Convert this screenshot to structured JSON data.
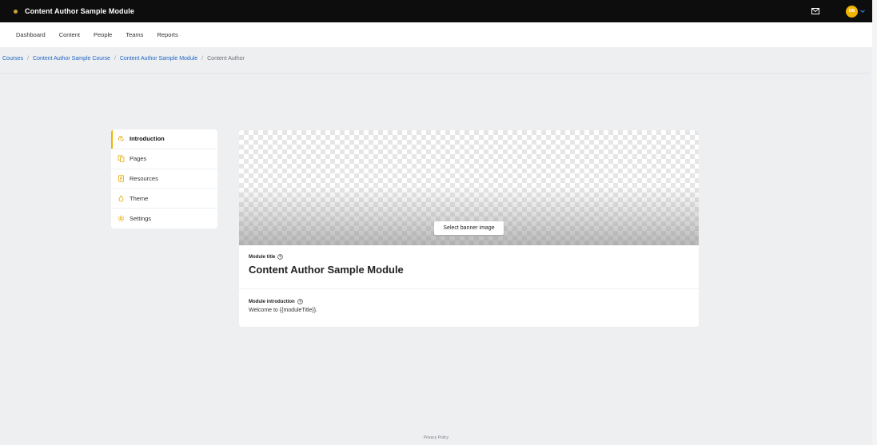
{
  "header": {
    "app_title": "Content Author Sample Module",
    "avatar_initials": "DB",
    "icons": {
      "mail": "mail-icon",
      "chevron": "chevron-down-icon"
    }
  },
  "nav": {
    "items": [
      "Dashboard",
      "Content",
      "People",
      "Teams",
      "Reports"
    ]
  },
  "breadcrumb": {
    "links": [
      "Courses",
      "Content Author Sample Course",
      "Content Author Sample Module"
    ],
    "current": "Content Author",
    "separator": "/"
  },
  "side_menu": {
    "items": [
      {
        "label": "Introduction",
        "icon": "hand-wave-icon",
        "active": true
      },
      {
        "label": "Pages",
        "icon": "pages-icon",
        "active": false
      },
      {
        "label": "Resources",
        "icon": "resources-icon",
        "active": false
      },
      {
        "label": "Theme",
        "icon": "theme-drop-icon",
        "active": false
      },
      {
        "label": "Settings",
        "icon": "gear-icon",
        "active": false
      }
    ]
  },
  "editor": {
    "banner_button": "Select banner image",
    "module_title_label": "Module title",
    "module_title_value": "Content Author Sample Module",
    "module_intro_label": "Module introduction",
    "module_intro_value": "Welcome to {{moduleTitle}}."
  },
  "footer": {
    "privacy": "Privacy Policy"
  },
  "colors": {
    "accent": "#f0b400",
    "link": "#2167c4",
    "topbar": "#0d0d0d"
  }
}
